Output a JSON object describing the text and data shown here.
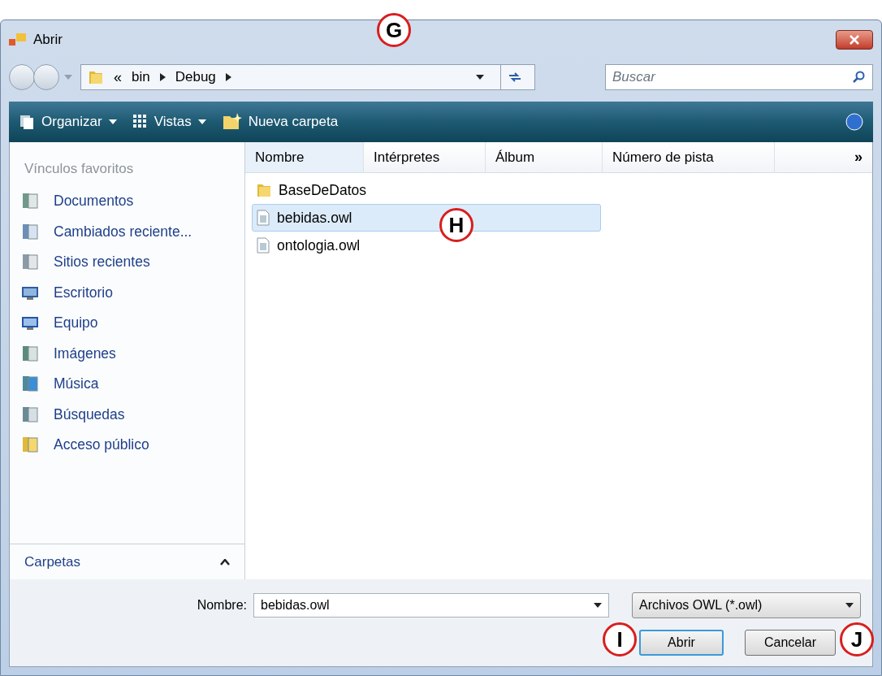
{
  "window": {
    "title": "Abrir"
  },
  "address": {
    "overflow": "«",
    "path": [
      "bin",
      "Debug"
    ]
  },
  "search": {
    "placeholder": "Buscar"
  },
  "toolbar": [
    {
      "label": "Organizar",
      "kind": "menu"
    },
    {
      "label": "Vistas",
      "kind": "menu"
    },
    {
      "label": "Nueva carpeta",
      "kind": "button"
    }
  ],
  "sidebar": {
    "heading": "Vínculos favoritos",
    "items": [
      {
        "label": "Documentos",
        "kind": "docs"
      },
      {
        "label": "Cambiados reciente...",
        "kind": "recent"
      },
      {
        "label": "Sitios recientes",
        "kind": "sites"
      },
      {
        "label": "Escritorio",
        "kind": "desktop"
      },
      {
        "label": "Equipo",
        "kind": "computer"
      },
      {
        "label": "Imágenes",
        "kind": "images"
      },
      {
        "label": "Música",
        "kind": "music"
      },
      {
        "label": "Búsquedas",
        "kind": "searches"
      },
      {
        "label": "Acceso público",
        "kind": "folder"
      }
    ],
    "folders_label": "Carpetas",
    "folders_expanded": false
  },
  "table": {
    "columns": [
      "Nombre",
      "Intérpretes",
      "Álbum",
      "Número de pista"
    ],
    "more": "»",
    "rows": [
      {
        "name": "BaseDeDatos",
        "kind": "folder",
        "selected": false
      },
      {
        "name": "bebidas.owl",
        "kind": "file",
        "selected": true
      },
      {
        "name": "ontologia.owl",
        "kind": "file",
        "selected": false
      }
    ]
  },
  "filename": {
    "label": "Nombre:",
    "value": "bebidas.owl"
  },
  "filter": {
    "value": "Archivos OWL (*.owl)"
  },
  "buttons": [
    {
      "label": "Abrir",
      "kind": "default"
    },
    {
      "label": "Cancelar",
      "kind": "normal"
    }
  ],
  "callouts": [
    {
      "letter": "G"
    },
    {
      "letter": "H"
    },
    {
      "letter": "I"
    },
    {
      "letter": "J"
    }
  ]
}
